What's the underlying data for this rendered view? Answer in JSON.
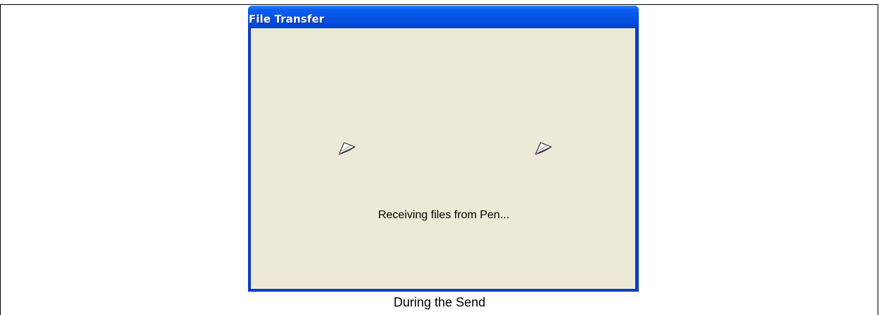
{
  "window": {
    "title": "File Transfer",
    "status_text": "Receiving files from Pen...",
    "icons": [
      "folder-transfer-icon",
      "folder-transfer-icon"
    ]
  },
  "caption": "During the Send",
  "colors": {
    "titlebar": "#0553e2",
    "window_body": "#ece9d8",
    "title_text": "#ffffff"
  }
}
